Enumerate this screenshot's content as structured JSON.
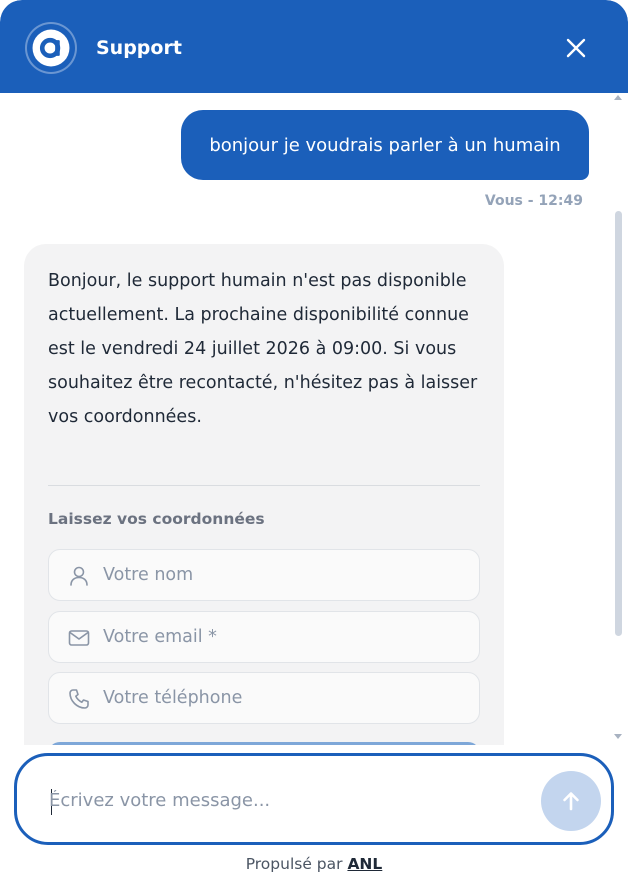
{
  "header": {
    "title": "Support",
    "logo_icon": "brand-a-logo",
    "close_icon": "close-icon",
    "background": "#1b5fba"
  },
  "conversation": {
    "user_message": {
      "text": "bonjour je voudrais parler à un humain",
      "meta": "Vous - 12:49"
    },
    "bot_message": {
      "text": "Bonjour, le support humain n'est pas disponible actuellement. La prochaine disponibilité connue est le vendredi 24 juillet 2026 à 09:00. Si vous souhaitez être recontacté, n'hésitez pas à laisser vos coordonnées.",
      "form": {
        "title": "Laissez vos coordonnées",
        "fields": [
          {
            "icon": "user-icon",
            "placeholder": "Votre nom",
            "value": ""
          },
          {
            "icon": "mail-icon",
            "placeholder": "Votre email *",
            "value": ""
          },
          {
            "icon": "phone-icon",
            "placeholder": "Votre téléphone",
            "value": ""
          }
        ]
      }
    }
  },
  "composer": {
    "placeholder": "Écrivez votre message...",
    "value": "",
    "send_icon": "arrow-up-icon"
  },
  "footer": {
    "prefix": "Propulsé par",
    "brand": "ANL"
  },
  "colors": {
    "accent": "#1b5fba",
    "bot_bubble": "#f3f3f4",
    "muted_text": "#94a3b8"
  }
}
